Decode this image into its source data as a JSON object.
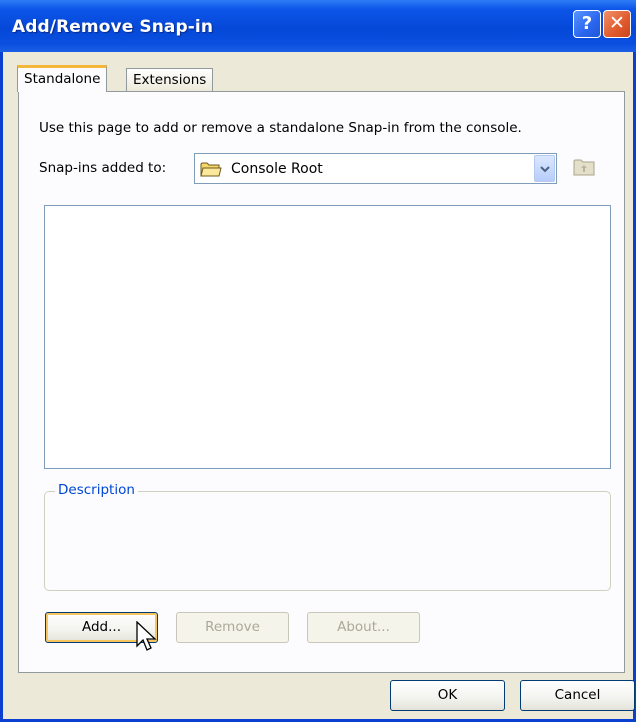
{
  "window": {
    "title": "Add/Remove Snap-in",
    "help_glyph": "?",
    "close_glyph": "✕",
    "help_icon": "help-button-icon",
    "close_icon": "close-x-icon"
  },
  "tabs": [
    {
      "label": "Standalone",
      "active": true
    },
    {
      "label": "Extensions",
      "active": false
    }
  ],
  "standalone": {
    "intro_text": "Use this page to add or remove a standalone Snap-in from the console.",
    "snapins_label": "Snap-ins added to:",
    "combo_value": "Console Root",
    "combo_icon": "folder-icon",
    "up_folder_icon": "up-one-level-folder-icon",
    "snapin_list": [],
    "description_label": "Description",
    "description_text": ""
  },
  "buttons": {
    "add": "Add...",
    "remove": "Remove",
    "about": "About...",
    "ok": "OK",
    "cancel": "Cancel"
  },
  "colors": {
    "titlebar": "#0548d8",
    "dialog_face": "#ece9d8",
    "tab_highlight": "#f3b73a",
    "group_title": "#0046d5",
    "close_button": "#e05a2c"
  }
}
